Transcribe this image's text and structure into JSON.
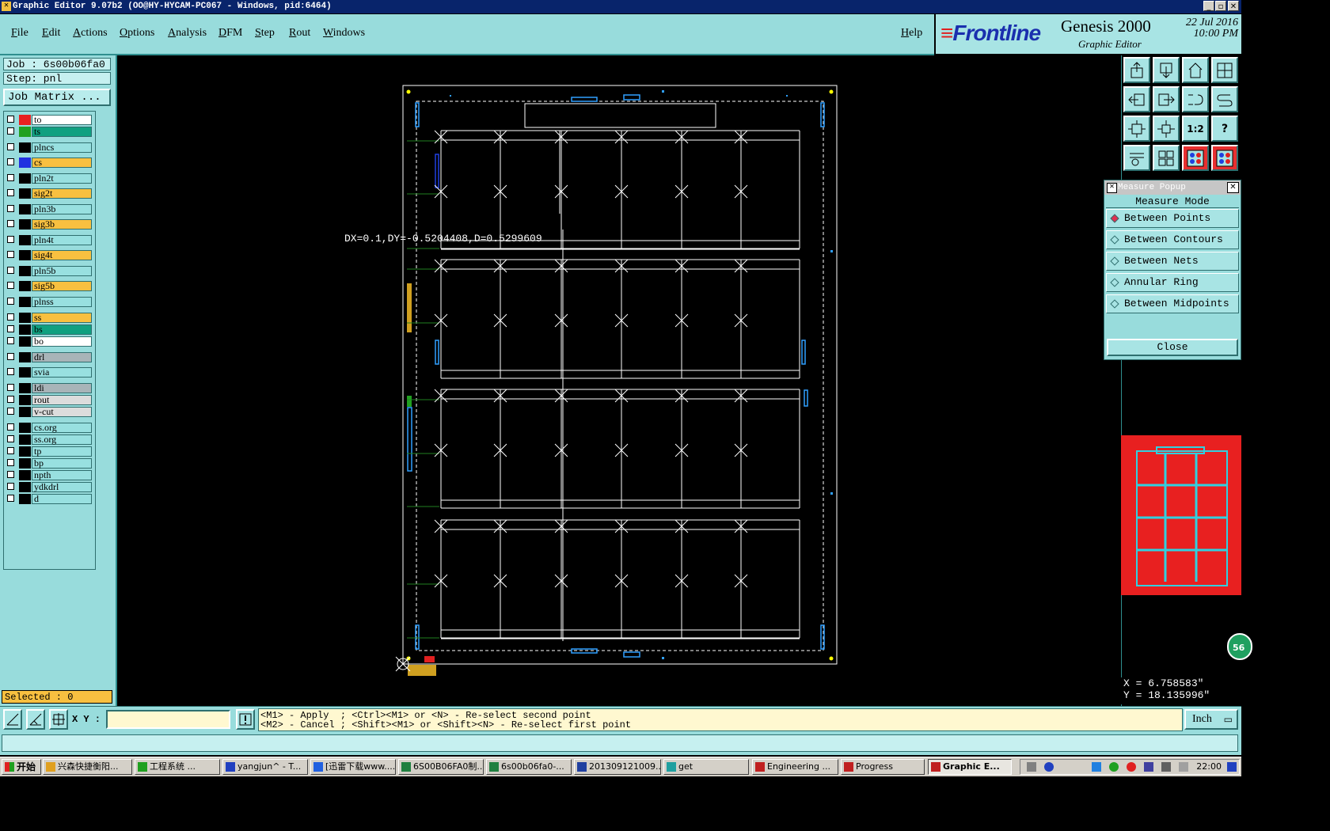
{
  "window": {
    "title": "Graphic Editor 9.07b2 (OO@HY-HYCAM-PC067 - Windows, pid:6464)"
  },
  "menu": [
    "File",
    "Edit",
    "Actions",
    "Options",
    "Analysis",
    "DFM",
    "Step",
    "Rout",
    "Windows"
  ],
  "help_label": "Help",
  "brand": {
    "logo": "Frontline",
    "product": "Genesis 2000",
    "subtitle": "Graphic Editor",
    "date": "22 Jul 2016",
    "time": "10:00 PM"
  },
  "job": {
    "job_label": "Job : 6s00b06fa0",
    "step_label": "Step: pnl",
    "matrix_button": "Job Matrix ..."
  },
  "layers": [
    {
      "name": "to",
      "color": "#e82020",
      "bg": "#ffffff"
    },
    {
      "name": "ts",
      "color": "#20a020",
      "bg": "#10a080"
    },
    {
      "name": "plncs",
      "color": "#000000",
      "bg": "#98e0e0"
    },
    {
      "name": "cs",
      "color": "#2030e0",
      "bg": "#f8c040"
    },
    {
      "name": "pln2t",
      "color": "#000000",
      "bg": "#98e0e0"
    },
    {
      "name": "sig2t",
      "color": "#000000",
      "bg": "#f8c040"
    },
    {
      "name": "pln3b",
      "color": "#000000",
      "bg": "#98e0e0"
    },
    {
      "name": "sig3b",
      "color": "#000000",
      "bg": "#f8c040"
    },
    {
      "name": "pln4t",
      "color": "#000000",
      "bg": "#98e0e0"
    },
    {
      "name": "sig4t",
      "color": "#000000",
      "bg": "#f8c040"
    },
    {
      "name": "pln5b",
      "color": "#000000",
      "bg": "#98e0e0"
    },
    {
      "name": "sig5b",
      "color": "#000000",
      "bg": "#f8c040"
    },
    {
      "name": "plnss",
      "color": "#000000",
      "bg": "#98e0e0"
    },
    {
      "name": "ss",
      "color": "#000000",
      "bg": "#f8c040"
    },
    {
      "name": "bs",
      "color": "#000000",
      "bg": "#10a080"
    },
    {
      "name": "bo",
      "color": "#000000",
      "bg": "#ffffff"
    },
    {
      "name": "drl",
      "color": "#000000",
      "bg": "#a8b4b8"
    },
    {
      "name": "svia",
      "color": "#000000",
      "bg": "#98e0e0"
    },
    {
      "name": "ldi",
      "color": "#000000",
      "bg": "#a8b4b8"
    },
    {
      "name": "rout",
      "color": "#000000",
      "bg": "#dcdcdc"
    },
    {
      "name": "v-cut",
      "color": "#000000",
      "bg": "#dcdcdc"
    },
    {
      "name": "cs.org",
      "color": "#000000",
      "bg": "#98e0e0"
    },
    {
      "name": "ss.org",
      "color": "#000000",
      "bg": "#98e0e0"
    },
    {
      "name": "tp",
      "color": "#000000",
      "bg": "#98e0e0"
    },
    {
      "name": "bp",
      "color": "#000000",
      "bg": "#98e0e0"
    },
    {
      "name": "npth",
      "color": "#000000",
      "bg": "#98e0e0"
    },
    {
      "name": "ydkdrl",
      "color": "#000000",
      "bg": "#98e0e0"
    },
    {
      "name": "d",
      "color": "#000000",
      "bg": "#98e0e0"
    }
  ],
  "selected_label": "Selected : 0",
  "measure_readout": "DX=0.1,DY=-0.5204408,D=0.5299609",
  "measure_popup": {
    "title": "Measure Popup",
    "heading": "Measure Mode",
    "options": [
      "Between Points",
      "Between Contours",
      "Between Nets",
      "Annular Ring",
      "Between Midpoints"
    ],
    "selected": "Between Points",
    "close_label": "Close"
  },
  "coords": {
    "x": "X = 6.758583\"",
    "y": "Y = 18.135996\""
  },
  "badge": "56",
  "bottom": {
    "xy_label": "X Y :",
    "xy_value": "",
    "hint_line1": "<M1> - Apply  ; <Ctrl><M1> or <N> - Re-select second point",
    "hint_line2": "<M2> - Cancel ; <Shift><M1> or <Shift><N> - Re-select first point",
    "units": "Inch"
  },
  "taskbar": {
    "start": "开始",
    "tasks": [
      {
        "label": "兴森快捷衡阳...",
        "icon": "#e0a020"
      },
      {
        "label": "工程系统    ...",
        "icon": "#20a020"
      },
      {
        "label": "yangjun^ - T...",
        "icon": "#2040c0"
      },
      {
        "label": "[迅雷下载www....",
        "icon": "#2060e0"
      },
      {
        "label": "6S00B06FA0制...",
        "icon": "#208040"
      },
      {
        "label": "6s00b06fa0-...",
        "icon": "#208040"
      },
      {
        "label": "201309121009...",
        "icon": "#2040a0"
      },
      {
        "label": "get",
        "icon": "#20a0a0"
      },
      {
        "label": "Engineering ...",
        "icon": "#c02020"
      },
      {
        "label": "Progress",
        "icon": "#c02020"
      },
      {
        "label": "Graphic E...",
        "icon": "#c02020",
        "active": true
      }
    ],
    "clock": "22:00"
  }
}
